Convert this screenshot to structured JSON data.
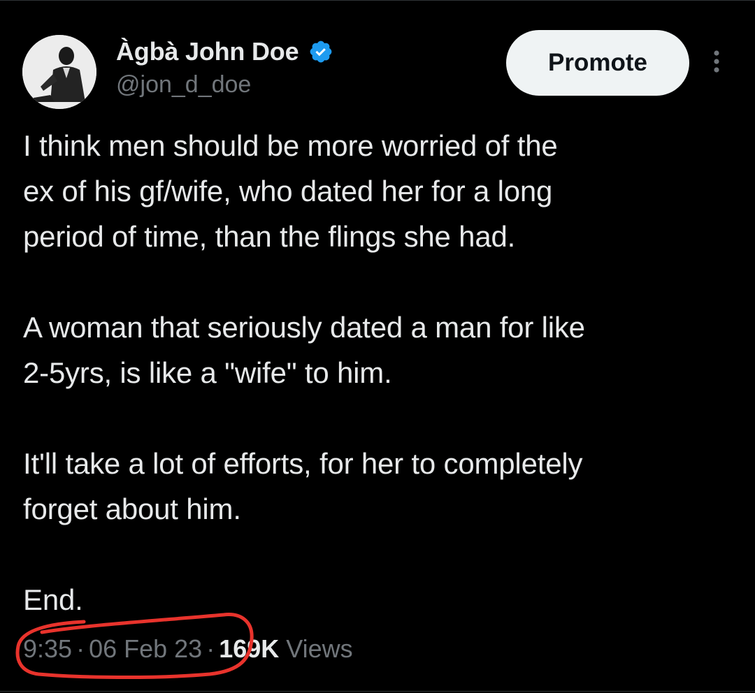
{
  "user": {
    "display_name": "Àgbà John Doe",
    "handle": "@jon_d_doe",
    "verified": true,
    "verified_color": "#1d9bf0"
  },
  "header": {
    "promote_label": "Promote",
    "more_icon": "more-vertical-icon"
  },
  "tweet": {
    "paragraphs": [
      "I think men should be more worried of the\nex of his gf/wife, who dated her for a long\nperiod of time, than the flings she had.",
      "A woman that seriously dated a man for like\n2-5yrs, is like a \"wife\" to him.",
      "It'll take a lot of efforts, for her to completely\nforget about him.",
      "End."
    ],
    "time": "9:35",
    "date": "06 Feb 23",
    "separator": "·",
    "views_count": "169K",
    "views_label": "Views"
  },
  "colors": {
    "background": "#000000",
    "text_primary": "#e7e9ea",
    "text_secondary": "#71767b",
    "annotation_red": "#e8332c"
  }
}
